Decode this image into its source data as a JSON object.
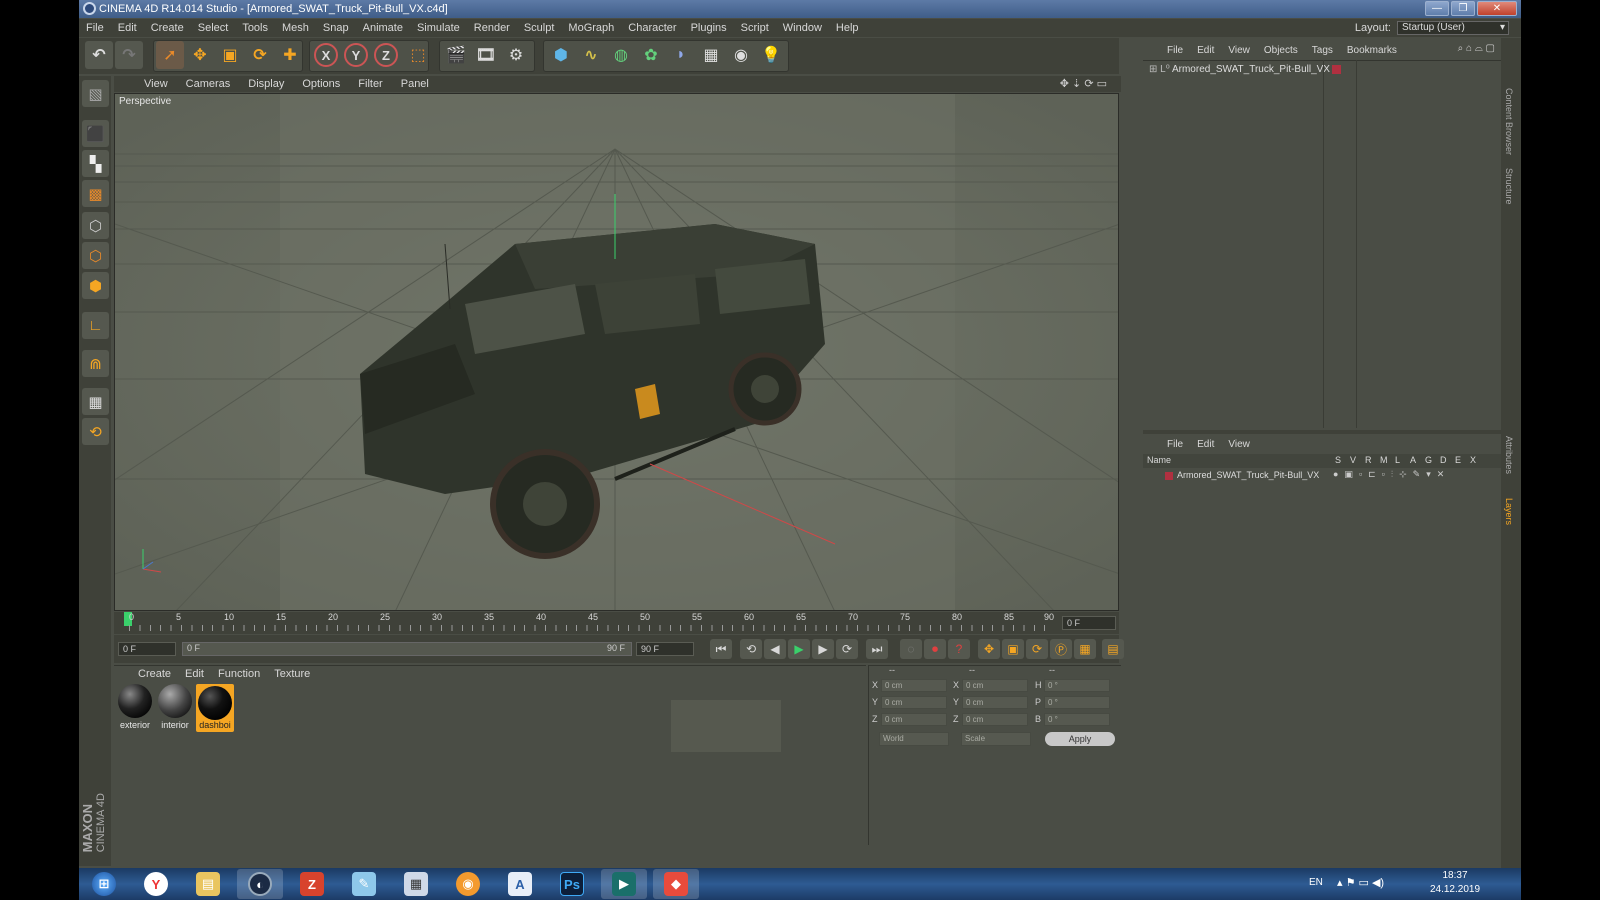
{
  "window": {
    "title": "CINEMA 4D R14.014 Studio - [Armored_SWAT_Truck_Pit-Bull_VX.c4d]",
    "controls": [
      "—",
      "❐",
      "✕"
    ]
  },
  "menubar": {
    "items": [
      "File",
      "Edit",
      "Create",
      "Select",
      "Tools",
      "Mesh",
      "Snap",
      "Animate",
      "Simulate",
      "Render",
      "Sculpt",
      "MoGraph",
      "Character",
      "Plugins",
      "Script",
      "Window",
      "Help"
    ],
    "layout_label": "Layout:",
    "layout_value": "Startup (User)"
  },
  "toolbar": {
    "icons": [
      "undo-icon",
      "redo-icon",
      "live-select-icon",
      "move-icon",
      "scale-icon",
      "rotate-icon",
      "add-icon",
      "x-axis-icon",
      "y-axis-icon",
      "z-axis-icon",
      "world-coord-icon",
      "render-view-icon",
      "render-picture-icon",
      "render-settings-icon",
      "cube-icon",
      "spline-icon",
      "nurbs-icon",
      "array-icon",
      "deformer-icon",
      "floor-icon",
      "camera-icon",
      "light-icon"
    ],
    "axis_labels": [
      "X",
      "Y",
      "Z"
    ]
  },
  "viewport": {
    "menu": [
      "View",
      "Cameras",
      "Display",
      "Options",
      "Filter",
      "Panel"
    ],
    "label": "Perspective"
  },
  "timeline": {
    "ticks": [
      "0",
      "5",
      "10",
      "15",
      "20",
      "25",
      "30",
      "35",
      "40",
      "45",
      "50",
      "55",
      "60",
      "65",
      "70",
      "75",
      "80",
      "85",
      "90"
    ],
    "current_frame": "0 F",
    "start_field": "0 F",
    "slider_start": "0 F",
    "slider_end": "90 F",
    "end_field": "90 F"
  },
  "materials": {
    "menu": [
      "Create",
      "Edit",
      "Function",
      "Texture"
    ],
    "items": [
      {
        "label": "exterior",
        "selected": false
      },
      {
        "label": "interior",
        "selected": false
      },
      {
        "label": "dashboi",
        "selected": true
      }
    ]
  },
  "coordinates": {
    "headers": [
      "--",
      "--",
      "--"
    ],
    "rows": [
      {
        "a": "X",
        "av": "0 cm",
        "b": "X",
        "bv": "0 cm",
        "c": "H",
        "cv": "0 °"
      },
      {
        "a": "Y",
        "av": "0 cm",
        "b": "Y",
        "bv": "0 cm",
        "c": "P",
        "cv": "0 °"
      },
      {
        "a": "Z",
        "av": "0 cm",
        "b": "Z",
        "bv": "0 cm",
        "c": "B",
        "cv": "0 °"
      }
    ],
    "mode": "World",
    "size_mode": "Scale",
    "apply_label": "Apply"
  },
  "object_manager": {
    "menu": [
      "File",
      "Edit",
      "View",
      "Objects",
      "Tags",
      "Bookmarks"
    ],
    "object_name": "Armored_SWAT_Truck_Pit-Bull_VX"
  },
  "layer_manager": {
    "menu": [
      "File",
      "Edit",
      "View"
    ],
    "columns": [
      "Name",
      "S",
      "V",
      "R",
      "M",
      "L",
      "A",
      "G",
      "D",
      "E",
      "X"
    ],
    "layer_name": "Armored_SWAT_Truck_Pit-Bull_VX"
  },
  "side_tabs": [
    "Content Browser",
    "Structure",
    "Attributes",
    "Layers"
  ],
  "branding": {
    "line1": "MAXON",
    "line2": "CINEMA 4D"
  },
  "taskbar": {
    "apps": [
      "start-icon",
      "yandex-icon",
      "explorer-icon",
      "cinema4d-icon",
      "filezilla-icon",
      "notepad-icon",
      "calculator-icon",
      "viewer-icon",
      "editor-icon",
      "photoshop-icon",
      "terminal-icon",
      "anydesk-icon"
    ],
    "photoshop_label": "Ps",
    "yandex_label": "Y",
    "lang": "EN",
    "time": "18:37",
    "date": "24.12.2019"
  },
  "colors": {
    "accent": "#f5a623",
    "panel": "#4a4d45",
    "viewport": "#6a6e62"
  }
}
